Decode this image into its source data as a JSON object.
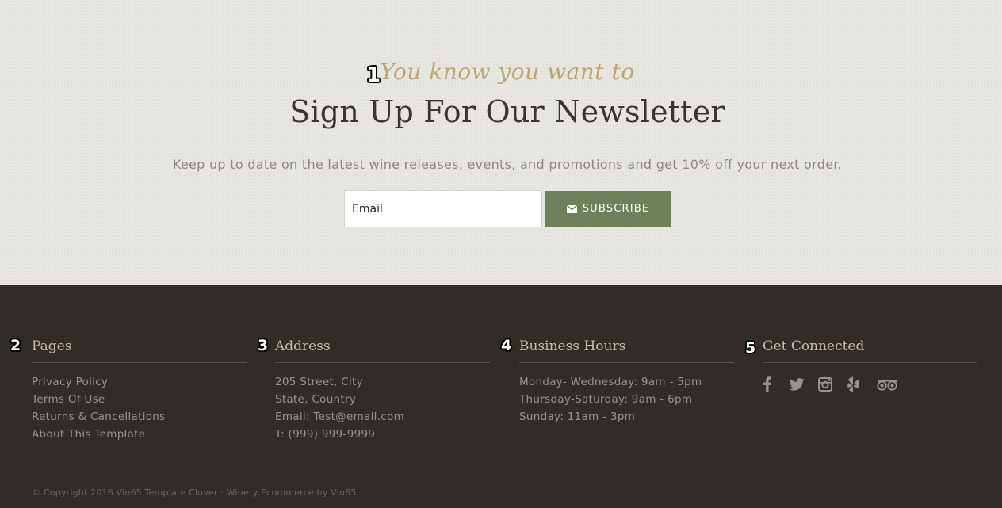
{
  "newsletter": {
    "tagline": "You know you want to",
    "headline": "Sign Up For Our Newsletter",
    "lead": "Keep up to date on the latest wine releases, events, and promotions and get 10% off your next order.",
    "email_placeholder": "Email",
    "subscribe_label": "SUBSCRIBE",
    "icon": "mail-icon"
  },
  "badges": [
    "1",
    "2",
    "3",
    "4",
    "5"
  ],
  "footer": {
    "pages": {
      "title": "Pages",
      "items": [
        "Privacy Policy",
        "Terms Of Use",
        "Returns & Cancellations",
        "About This Template"
      ]
    },
    "address": {
      "title": "Address",
      "lines": [
        "205 Street, City",
        "State, Country",
        "Email: Test@email.com",
        "T: (999) 999-9999"
      ]
    },
    "hours": {
      "title": "Business Hours",
      "lines": [
        "Monday- Wednesday: 9am - 5pm",
        "Thursday-Saturday: 9am - 6pm",
        "Sunday: 11am - 3pm"
      ]
    },
    "connected": {
      "title": "Get Connected",
      "icons": [
        "facebook-icon",
        "twitter-icon",
        "instagram-icon",
        "yelp-icon",
        "tripadvisor-icon"
      ]
    },
    "copyright": "© Copyright 2016 Vin65 Template Clover  ·  Winery Ecommerce by Vin65"
  },
  "colors": {
    "accent_green": "#6e8059",
    "tagline_gold": "#b8a66e",
    "footer_bg": "#322c29",
    "newsletter_bg": "#e8e6e1"
  }
}
